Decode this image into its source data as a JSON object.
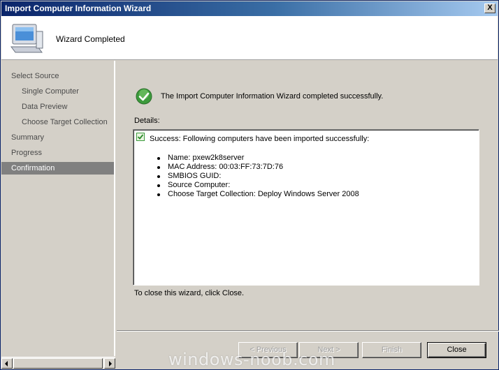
{
  "window": {
    "title": "Import Computer Information Wizard",
    "close_glyph": "X"
  },
  "header": {
    "title": "Wizard Completed",
    "icon": "computer-icon"
  },
  "sidebar": {
    "items": [
      {
        "label": "Select Source",
        "level": 0
      },
      {
        "label": "Single Computer",
        "level": 1
      },
      {
        "label": "Data Preview",
        "level": 1
      },
      {
        "label": "Choose Target Collection",
        "level": 1
      },
      {
        "label": "Summary",
        "level": 0
      },
      {
        "label": "Progress",
        "level": 0
      },
      {
        "label": "Confirmation",
        "level": 0,
        "active": true
      }
    ]
  },
  "main": {
    "success_message": "The Import Computer Information Wizard completed successfully.",
    "details_label": "Details:",
    "details": {
      "headline": "Success: Following computers have been imported successfully:",
      "items": [
        "Name: pxew2k8server",
        "MAC Address: 00:03:FF:73:7D:76",
        "SMBIOS GUID:",
        "Source Computer:",
        "Choose Target Collection: Deploy Windows Server 2008"
      ]
    },
    "close_hint": "To close this wizard, click Close."
  },
  "buttons": {
    "previous": "< Previous",
    "next": "Next >",
    "finish": "Finish",
    "close": "Close"
  },
  "watermark": "windows-noob.com",
  "colors": {
    "titlebar": "#0a246a",
    "active_nav": "#808080",
    "success_green": "#3c9a3c"
  }
}
